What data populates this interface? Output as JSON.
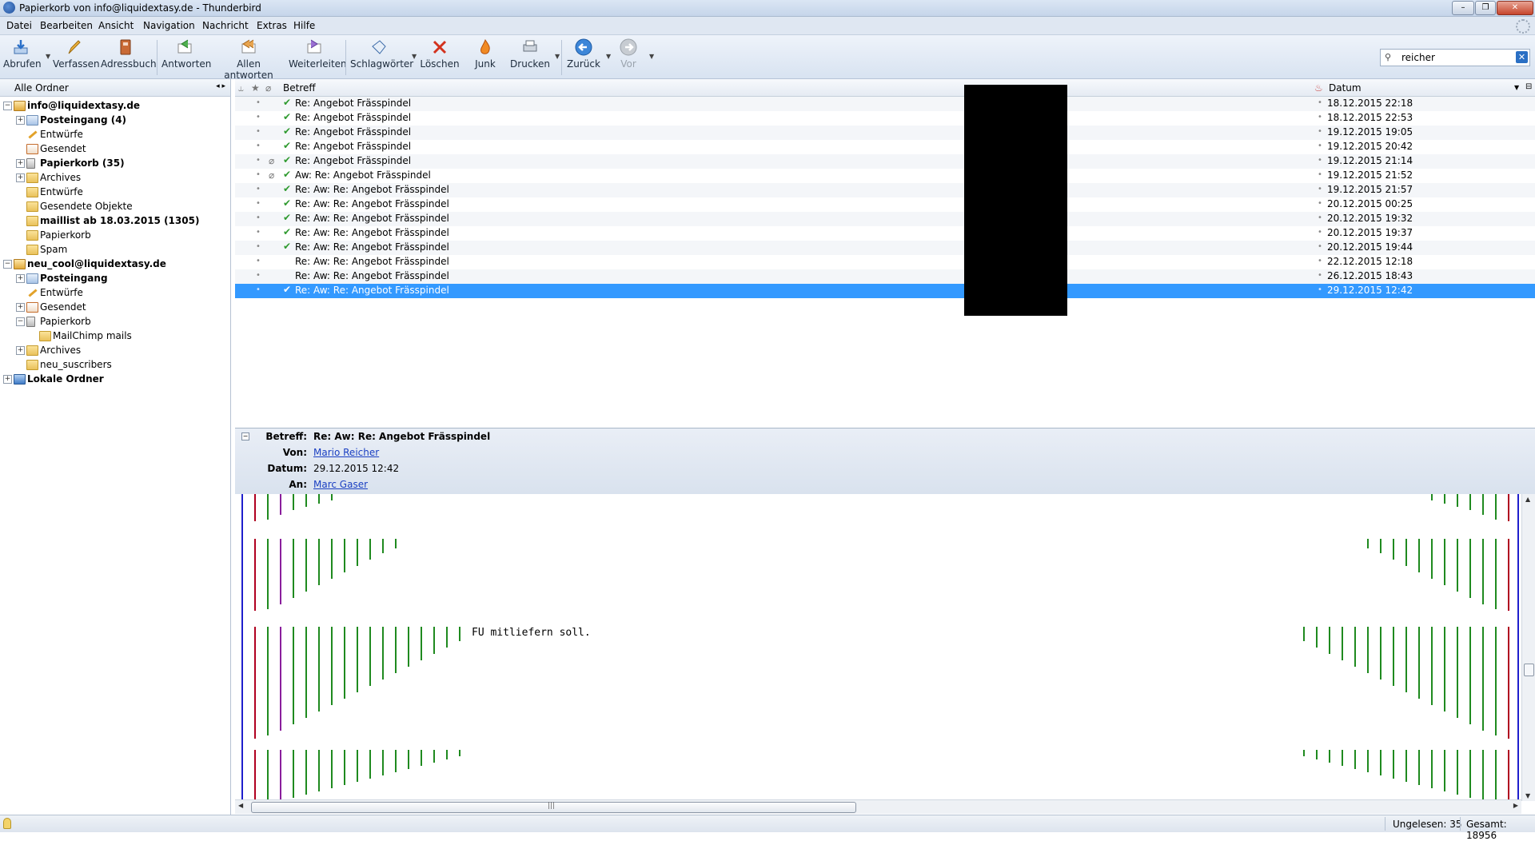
{
  "window": {
    "title": "Papierkorb von info@liquidextasy.de - Thunderbird"
  },
  "menu": [
    "Datei",
    "Bearbeiten",
    "Ansicht",
    "Navigation",
    "Nachricht",
    "Extras",
    "Hilfe"
  ],
  "toolbar": {
    "get": "Abrufen",
    "compose": "Verfassen",
    "addressbook": "Adressbuch",
    "reply": "Antworten",
    "reply_all": "Allen antworten",
    "forward": "Weiterleiten",
    "tags": "Schlagwörter",
    "delete": "Löschen",
    "junk": "Junk",
    "print": "Drucken",
    "back": "Zurück",
    "forward_nav": "Vor"
  },
  "search": {
    "value": "reicher"
  },
  "folders": {
    "header": "Alle Ordner",
    "items": [
      {
        "label": "info@liquidextasy.de",
        "bold": true
      },
      {
        "label": "Posteingang (4)",
        "bold": true
      },
      {
        "label": "Entwürfe"
      },
      {
        "label": "Gesendet"
      },
      {
        "label": "Papierkorb (35)",
        "bold": true
      },
      {
        "label": "Archives"
      },
      {
        "label": "Entwürfe"
      },
      {
        "label": "Gesendete Objekte"
      },
      {
        "label": "maillist ab 18.03.2015 (1305)",
        "bold": true
      },
      {
        "label": "Papierkorb"
      },
      {
        "label": "Spam"
      },
      {
        "label": "neu_cool@liquidextasy.de",
        "bold": true
      },
      {
        "label": "Posteingang",
        "bold": true
      },
      {
        "label": "Entwürfe"
      },
      {
        "label": "Gesendet"
      },
      {
        "label": "Papierkorb"
      },
      {
        "label": "MailChimp mails"
      },
      {
        "label": "Archives"
      },
      {
        "label": "neu_suscribers"
      },
      {
        "label": "Lokale Ordner",
        "bold": true
      }
    ]
  },
  "threads": {
    "col_subject": "Betreff",
    "col_date": "Datum",
    "rows": [
      {
        "subject": "Re: Angebot Frässpindel",
        "date": "18.12.2015 22:18"
      },
      {
        "subject": "Re: Angebot Frässpindel",
        "date": "18.12.2015 22:53"
      },
      {
        "subject": "Re: Angebot Frässpindel",
        "date": "19.12.2015 19:05"
      },
      {
        "subject": "Re: Angebot Frässpindel",
        "date": "19.12.2015 20:42"
      },
      {
        "subject": "Re: Angebot Frässpindel",
        "date": "19.12.2015 21:14"
      },
      {
        "subject": "Aw: Re: Angebot Frässpindel",
        "date": "19.12.2015 21:52"
      },
      {
        "subject": "Re: Aw: Re: Angebot Frässpindel",
        "date": "19.12.2015 21:57"
      },
      {
        "subject": "Re: Aw: Re: Angebot Frässpindel",
        "date": "20.12.2015 00:25"
      },
      {
        "subject": "Re: Aw: Re: Angebot Frässpindel",
        "date": "20.12.2015 19:32"
      },
      {
        "subject": "Re: Aw: Re: Angebot Frässpindel",
        "date": "20.12.2015 19:37"
      },
      {
        "subject": "Re: Aw: Re: Angebot Frässpindel",
        "date": "20.12.2015 19:44"
      },
      {
        "subject": "Re: Aw: Re: Angebot Frässpindel",
        "date": "22.12.2015 12:18"
      },
      {
        "subject": "Re: Aw: Re: Angebot Frässpindel",
        "date": "26.12.2015 18:43"
      },
      {
        "subject": "Re: Aw: Re: Angebot Frässpindel",
        "date": "29.12.2015 12:42"
      }
    ]
  },
  "message": {
    "subject_label": "Betreff:",
    "subject": "Re: Aw: Re: Angebot Frässpindel",
    "from_label": "Von:",
    "from": "Mario Reicher",
    "date_label": "Datum:",
    "date": "29.12.2015 12:42",
    "to_label": "An:",
    "to": "Marc Gaser",
    "body_text": "FU mitliefern soll."
  },
  "status": {
    "unread": "Ungelesen: 35",
    "total": "Gesamt: 18956"
  },
  "colors": {
    "selection": "#3399ff",
    "replied": "#2f9a2f",
    "quote1": "#1f1fcc",
    "quote2": "#b00020",
    "quote3": "#8a1e9c",
    "quote4": "#1f8a1f"
  }
}
